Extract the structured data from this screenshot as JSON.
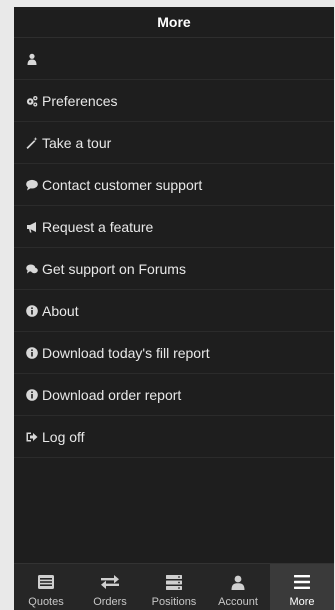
{
  "header": {
    "title": "More"
  },
  "menu": [
    {
      "label": "",
      "icon": "user-icon"
    },
    {
      "label": "Preferences",
      "icon": "cogs-icon"
    },
    {
      "label": "Take a tour",
      "icon": "magic-wand-icon"
    },
    {
      "label": "Contact customer support",
      "icon": "comment-icon"
    },
    {
      "label": "Request a feature",
      "icon": "bullhorn-icon"
    },
    {
      "label": "Get support on Forums",
      "icon": "comments-icon"
    },
    {
      "label": "About",
      "icon": "info-circle-icon"
    },
    {
      "label": "Download today's fill report",
      "icon": "info-circle-icon"
    },
    {
      "label": "Download order report",
      "icon": "info-circle-icon"
    },
    {
      "label": "Log off",
      "icon": "sign-out-icon"
    }
  ],
  "tabs": [
    {
      "label": "Quotes",
      "icon": "quotes-icon"
    },
    {
      "label": "Orders",
      "icon": "exchange-icon"
    },
    {
      "label": "Positions",
      "icon": "server-icon"
    },
    {
      "label": "Account",
      "icon": "user-icon"
    },
    {
      "label": "More",
      "icon": "bars-icon",
      "active": true
    }
  ]
}
